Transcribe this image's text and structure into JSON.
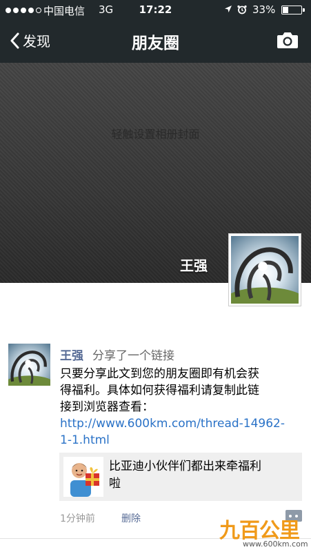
{
  "status_bar": {
    "carrier": "中国电信",
    "network": "3G",
    "time": "17:22",
    "battery": "33%",
    "battery_level": 0.33
  },
  "nav": {
    "back_label": "发现",
    "title": "朋友圈",
    "camera_icon": "camera-icon"
  },
  "cover": {
    "hint": "轻触设置相册封面",
    "user_name": "王强"
  },
  "post": {
    "author": "王强",
    "action": "分享了一个链接",
    "text_lines": [
      "只要分享此文到您的朋友圈即有机会获",
      "得福利。具体如何获得福利请复制此链",
      "接到浏览器查看："
    ],
    "link_lines": [
      "http://www.600km.com/thread-14962-",
      "1-1.html"
    ],
    "share_card": {
      "title_lines": [
        "比亚迪小伙伴们都出来牵福利",
        "啦"
      ]
    },
    "time": "1分钟前",
    "delete_label": "删除"
  },
  "watermark": {
    "logo": "九百公里",
    "url": "www.600km.com"
  },
  "colors": {
    "nav_bg": "#22292c",
    "link": "#2a72c7",
    "name": "#576b95",
    "watermark": "#f09a1a"
  }
}
